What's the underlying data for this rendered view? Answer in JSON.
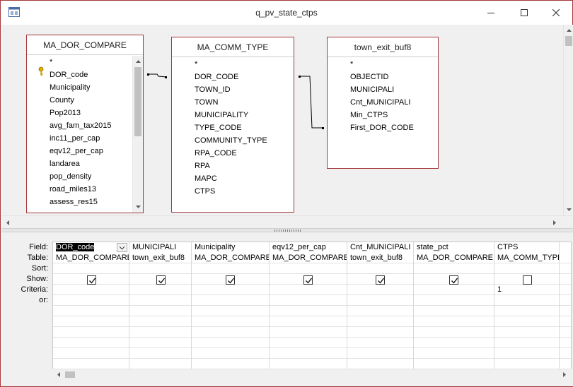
{
  "window": {
    "title": "q_pv_state_ctps",
    "app_icon": "access-query-icon",
    "controls": [
      "minimize-icon",
      "maximize-icon",
      "close-icon"
    ]
  },
  "design_tables": [
    {
      "name": "MA_DOR_COMPARE",
      "fields": [
        "*",
        "DOR_code",
        "Municipality",
        "County",
        "Pop2013",
        "avg_fam_tax2015",
        "inc11_per_cap",
        "eqv12_per_cap",
        "landarea",
        "pop_density",
        "road_miles13",
        "assess_res15"
      ],
      "key_field": "DOR_code"
    },
    {
      "name": "MA_COMM_TYPE",
      "fields": [
        "*",
        "DOR_CODE",
        "TOWN_ID",
        "TOWN",
        "MUNICIPALITY",
        "TYPE_CODE",
        "COMMUNITY_TYPE",
        "RPA_CODE",
        "RPA",
        "MAPC",
        "CTPS"
      ]
    },
    {
      "name": "town_exit_buf8",
      "fields": [
        "*",
        "OBJECTID",
        "MUNICIPALI",
        "Cnt_MUNICIPALI",
        "Min_CTPS",
        "First_DOR_CODE"
      ]
    }
  ],
  "grid": {
    "row_labels": [
      "Field:",
      "Table:",
      "Sort:",
      "Show:",
      "Criteria:",
      "or:"
    ],
    "columns": [
      {
        "field": "DOR_code",
        "table": "MA_DOR_COMPARE",
        "sort": "",
        "show": true,
        "criteria": "",
        "or": ""
      },
      {
        "field": "MUNICIPALI",
        "table": "town_exit_buf8",
        "sort": "",
        "show": true,
        "criteria": "",
        "or": ""
      },
      {
        "field": "Municipality",
        "table": "MA_DOR_COMPARE",
        "sort": "",
        "show": true,
        "criteria": "",
        "or": ""
      },
      {
        "field": "eqv12_per_cap",
        "table": "MA_DOR_COMPARE",
        "sort": "",
        "show": true,
        "criteria": "",
        "or": ""
      },
      {
        "field": "Cnt_MUNICIPALI",
        "table": "town_exit_buf8",
        "sort": "",
        "show": true,
        "criteria": "",
        "or": ""
      },
      {
        "field": "state_pct",
        "table": "MA_DOR_COMPARE",
        "sort": "",
        "show": true,
        "criteria": "",
        "or": ""
      },
      {
        "field": "CTPS",
        "table": "MA_COMM_TYPE",
        "sort": "",
        "show": false,
        "criteria": "1",
        "or": ""
      }
    ]
  },
  "colors": {
    "window_border": "#a4373a",
    "table_border": "#a4373a",
    "design_bg": "#f0f0f0"
  }
}
